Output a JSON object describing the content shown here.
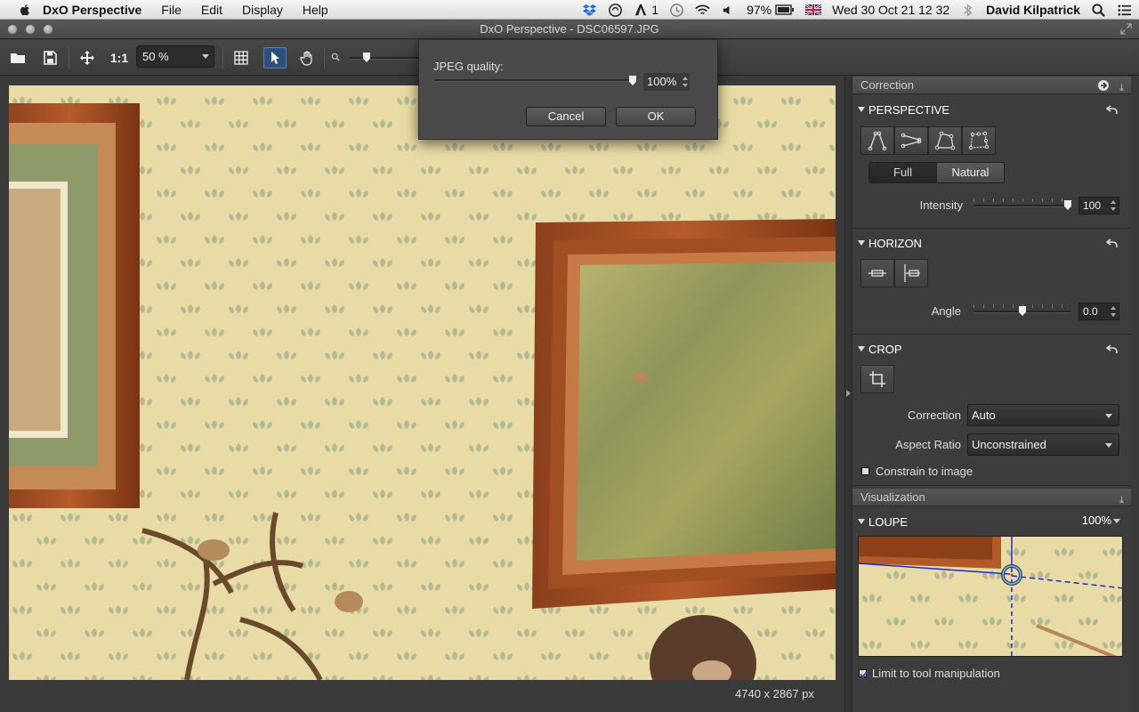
{
  "menubar": {
    "app_name": "DxO Perspective",
    "menus": [
      "File",
      "Edit",
      "Display",
      "Help"
    ],
    "adobe_count": "1",
    "battery": "97%",
    "datetime": "Wed 30 Oct  21 12 32",
    "user": "David Kilpatrick"
  },
  "window": {
    "title": "DxO Perspective - DSC06597.JPG"
  },
  "toolbar": {
    "one_to_one": "1:1",
    "zoom_value": "50 %"
  },
  "dialog": {
    "label": "JPEG quality:",
    "quality_value": "100%",
    "quality_percent": 100,
    "cancel_label": "Cancel",
    "ok_label": "OK"
  },
  "image": {
    "dimensions": "4740 x 2867 px"
  },
  "panel": {
    "correction_header": "Correction",
    "perspective": {
      "title": "PERSPECTIVE",
      "mode_full": "Full",
      "mode_natural": "Natural",
      "intensity_label": "Intensity",
      "intensity_value": "100",
      "intensity_fraction": 1.0
    },
    "horizon": {
      "title": "HORIZON",
      "angle_label": "Angle",
      "angle_value": "0.0",
      "angle_fraction": 0.5
    },
    "crop": {
      "title": "CROP",
      "correction_label": "Correction",
      "correction_value": "Auto",
      "aspect_label": "Aspect Ratio",
      "aspect_value": "Unconstrained",
      "constrain_label": "Constrain to image"
    },
    "visualization_header": "Visualization",
    "loupe": {
      "title": "LOUPE",
      "zoom": "100%",
      "limit_label": "Limit to tool manipulation"
    }
  }
}
